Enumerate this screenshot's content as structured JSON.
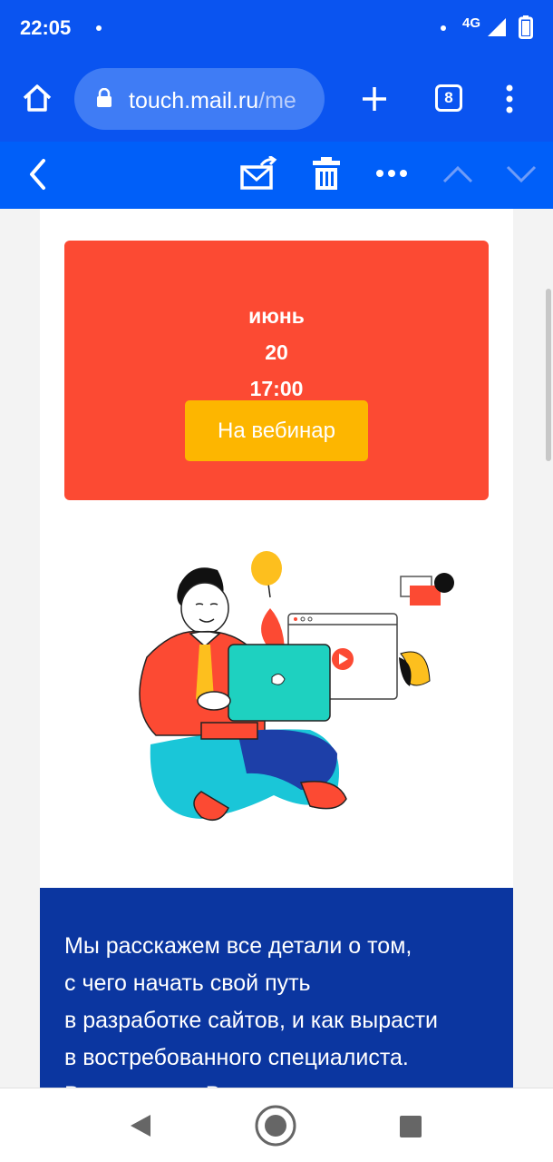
{
  "status_bar": {
    "time": "22:05",
    "network": "4G"
  },
  "browser": {
    "url_host": "touch.mail.ru",
    "url_path": "/me",
    "tab_count": "8"
  },
  "colors": {
    "bar_blue": "#0a54f0",
    "promo_red": "#fc4a33",
    "button_yellow": "#fdb600",
    "section_blue": "#0b36a0"
  },
  "icons": [
    "home-icon",
    "lock-icon",
    "plus-icon",
    "tabs-icon",
    "more-vert-icon",
    "back-icon",
    "move-to-folder-icon",
    "trash-icon",
    "more-horiz-icon",
    "chevron-up-icon",
    "chevron-down-icon",
    "nav-back-icon",
    "nav-home-icon",
    "nav-recents-icon"
  ],
  "promo": {
    "month": "июнь",
    "day": "20",
    "time": "17:00",
    "button_label": "На вебинар"
  },
  "body_lines": [
    "Мы расскажем все детали о том,",
    "с чего начать свой путь",
    "в разработке сайтов, и как вырасти",
    "в востребованного специалиста.",
    "Все вопросы Вы сможете задать"
  ]
}
